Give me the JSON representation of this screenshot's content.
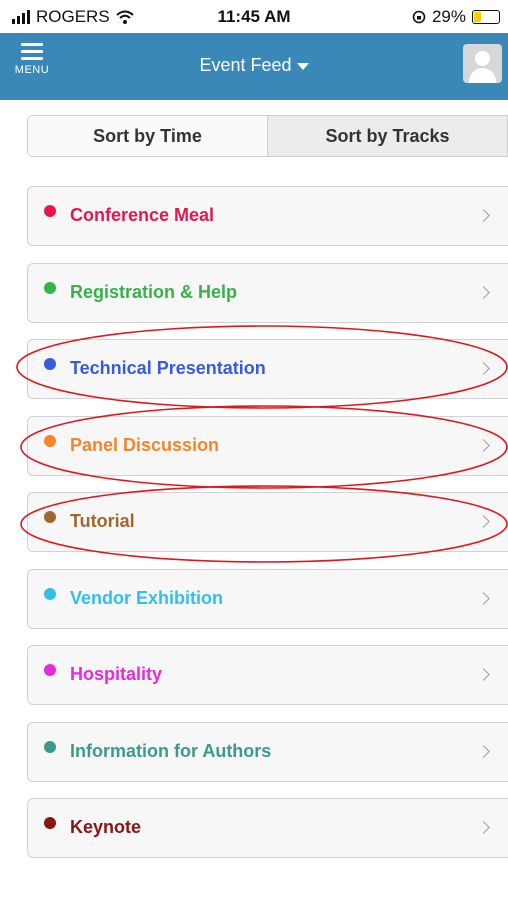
{
  "status": {
    "carrier": "ROGERS",
    "time": "11:45 AM",
    "battery_label": "29%",
    "battery_level": 0.29
  },
  "header": {
    "menu_label": "MENU",
    "title": "Event Feed"
  },
  "sort": {
    "by_time": "Sort by Time",
    "by_tracks": "Sort by Tracks"
  },
  "tracks": [
    {
      "label": "Conference Meal",
      "color": "#e8164c"
    },
    {
      "label": "Registration & Help",
      "color": "#35b34a"
    },
    {
      "label": "Technical Presentation",
      "color": "#3a5bd9"
    },
    {
      "label": "Panel Discussion",
      "color": "#f4852a"
    },
    {
      "label": "Tutorial",
      "color": "#a0682a"
    },
    {
      "label": "Vendor Exhibition",
      "color": "#33c0e6"
    },
    {
      "label": "Hospitality",
      "color": "#e62bd8"
    },
    {
      "label": "Information for Authors",
      "color": "#3c9a8c"
    },
    {
      "label": "Keynote",
      "color": "#8b1414"
    }
  ],
  "theme": {
    "header_bg": "#3a88b8",
    "annotation": "#e0161e"
  }
}
